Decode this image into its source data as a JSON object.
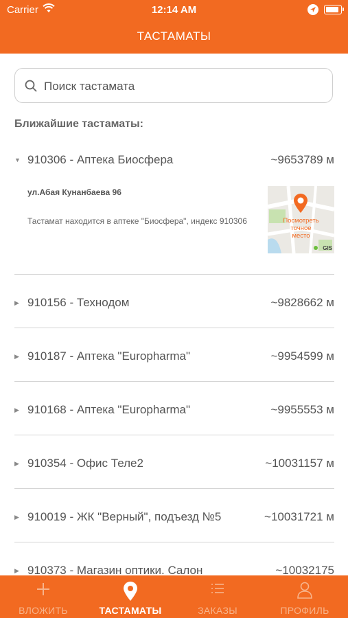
{
  "status_bar": {
    "carrier": "Carrier",
    "time": "12:14 AM"
  },
  "nav": {
    "title": "ТАСТАМАТЫ"
  },
  "search": {
    "placeholder": "Поиск тастамата"
  },
  "section_title": "Ближайшие тастаматы:",
  "expanded": {
    "title": "910306 - Аптека Биосфера",
    "distance": "~9653789 м",
    "address": "ул.Абая Кунанбаева 96",
    "description": "Тастамат находится в аптеке \"Биосфера\", индекс 910306",
    "map_label_line1": "Посмотреть",
    "map_label_line2": "точное",
    "map_label_line3": "место",
    "map_brand": "GIS"
  },
  "items": [
    {
      "title": "910156 - Технодом",
      "distance": "~9828662 м"
    },
    {
      "title": "910187 - Аптека \"Europharma\"",
      "distance": "~9954599 м"
    },
    {
      "title": "910168 - Аптека \"Europharma\"",
      "distance": "~9955553 м"
    },
    {
      "title": "910354 - Офис Теле2",
      "distance": "~10031157 м"
    },
    {
      "title": "910019 - ЖК \"Верный\", подъезд №5",
      "distance": "~10031721 м"
    },
    {
      "title": "910373 - Магазин оптики. Салон",
      "distance": "~10032175"
    }
  ],
  "tabs": [
    {
      "label": "ВЛОЖИТЬ",
      "icon": "plus-icon"
    },
    {
      "label": "ТАСТАМАТЫ",
      "icon": "location-pin-icon"
    },
    {
      "label": "ЗАКАЗЫ",
      "icon": "list-icon"
    },
    {
      "label": "ПРОФИЛЬ",
      "icon": "person-icon"
    }
  ],
  "colors": {
    "brand": "#f26a21"
  }
}
